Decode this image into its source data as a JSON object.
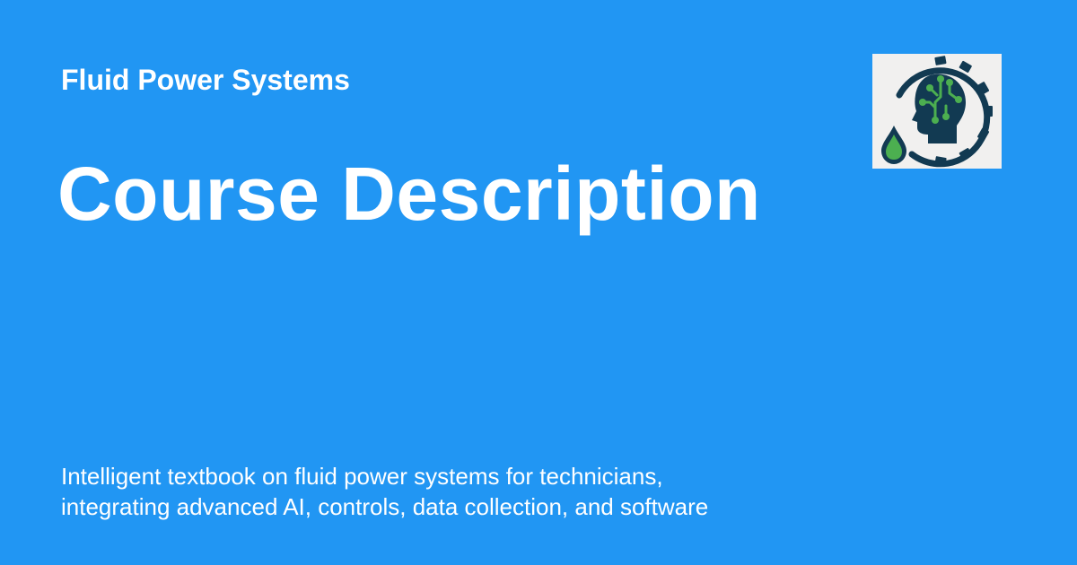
{
  "site": {
    "name": "Fluid Power Systems"
  },
  "page": {
    "title": "Course Description",
    "description_lines": [
      "Intelligent textbook on fluid power systems for technicians,",
      "integrating advanced AI, controls, data collection, and software"
    ]
  },
  "logo": {
    "icon": "gear-head-circuit-droplet-logo",
    "background_color": "#f1f0ef",
    "primary_color": "#123a52",
    "accent_color": "#4caf50"
  },
  "theme": {
    "background_color": "#2196f3",
    "text_color": "#ffffff"
  }
}
